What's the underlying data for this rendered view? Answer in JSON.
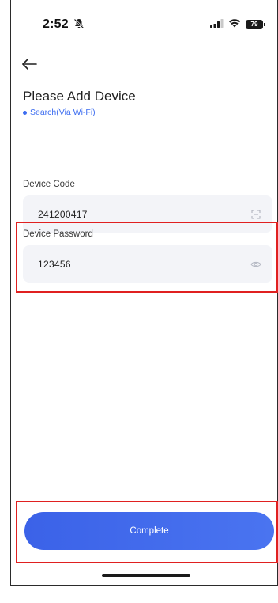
{
  "status_bar": {
    "time": "2:52",
    "battery": "79"
  },
  "header": {
    "title": "Please Add Device",
    "search_mode": "Search(Via Wi-Fi)"
  },
  "form": {
    "device_code": {
      "label": "Device Code",
      "value": "241200417"
    },
    "device_password": {
      "label": "Device Password",
      "value": "123456"
    }
  },
  "actions": {
    "complete_label": "Complete"
  },
  "colors": {
    "accent": "#3d6df0",
    "button": "#4a74f0",
    "field_bg": "#f3f4f8",
    "highlight": "#e02020"
  },
  "icons": [
    "bell-muted-icon",
    "signal-icon",
    "wifi-icon",
    "battery-icon",
    "back-arrow-icon",
    "scan-icon",
    "eye-icon"
  ]
}
